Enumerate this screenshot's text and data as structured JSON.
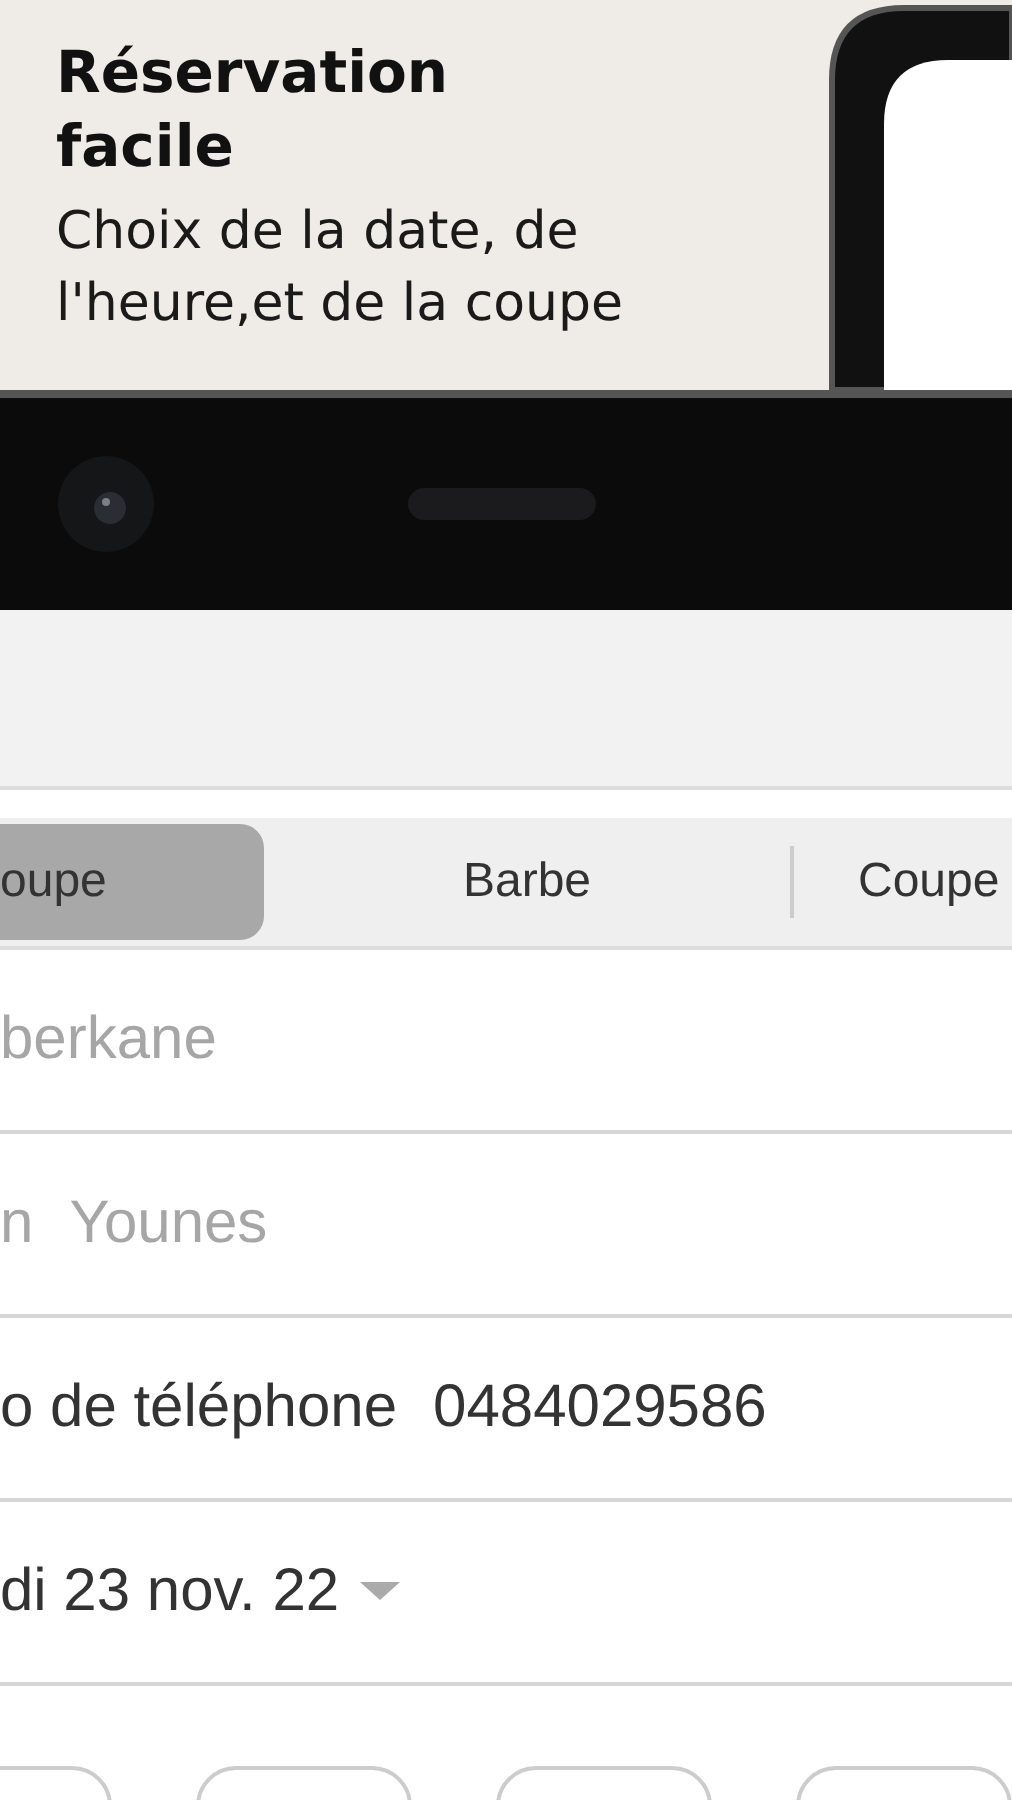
{
  "promo": {
    "title": "Réservation facile",
    "subtitle": "Choix de la date, de l'heure,et de la coupe"
  },
  "segments": [
    {
      "label": "oupe",
      "selected": true
    },
    {
      "label": "Barbe",
      "selected": false
    },
    {
      "label": "Coupe",
      "selected": false
    }
  ],
  "fields": [
    {
      "kind": "text",
      "placeholder": "berkane"
    },
    {
      "kind": "text",
      "label": "n",
      "placeholder": "Younes"
    },
    {
      "kind": "text",
      "label": "o de téléphone",
      "value": "0484029586"
    },
    {
      "kind": "dropdown",
      "value": "di 23 nov. 22"
    }
  ]
}
